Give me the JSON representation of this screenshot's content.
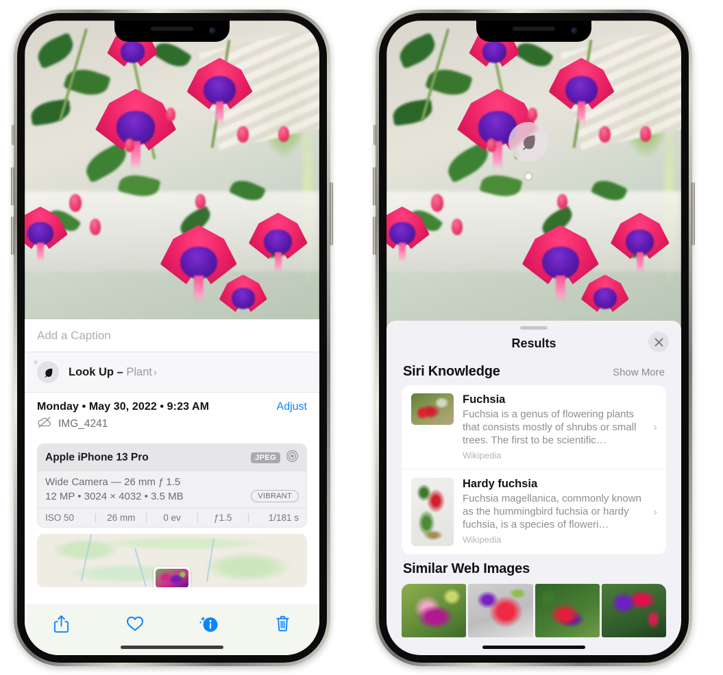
{
  "left_phone": {
    "photo": {
      "alt": "fuchsia-flowers-photo"
    },
    "caption": {
      "placeholder": "Add a Caption",
      "value": ""
    },
    "lookup": {
      "icon": "leaf-icon",
      "sparkle_icon": "sparkles-icon",
      "label": "Look Up – ",
      "subject": "Plant",
      "chevron": "›"
    },
    "meta": {
      "date": "Monday • May 30, 2022 • 9:23 AM",
      "adjust_label": "Adjust",
      "cloud_icon": "cloud-slash-icon",
      "filename": "IMG_4241"
    },
    "camera_card": {
      "device": "Apple iPhone 13 Pro",
      "format_badge": "JPEG",
      "lens_icon": "aperture-icon",
      "lens": "Wide Camera — 26 mm ƒ 1.5",
      "size_line": "12 MP • 3024 × 4032 • 3.5 MB",
      "vibrant_badge": "VIBRANT",
      "exif": [
        "ISO 50",
        "26 mm",
        "0 ev",
        "ƒ1.5",
        "1/181 s"
      ]
    },
    "map": {
      "name": "photo-location-map"
    },
    "toolbar": [
      {
        "name": "share-button",
        "icon": "share-icon"
      },
      {
        "name": "favorite-button",
        "icon": "heart-icon"
      },
      {
        "name": "info-button",
        "icon": "info-sparkle-icon"
      },
      {
        "name": "delete-button",
        "icon": "trash-icon"
      }
    ]
  },
  "right_phone": {
    "visual_lookup_badge": {
      "icon": "leaf-icon"
    },
    "sheet": {
      "title": "Results",
      "close_icon": "close-icon",
      "grabber": "drag-handle"
    },
    "siri_knowledge": {
      "title": "Siri Knowledge",
      "show_more": "Show More",
      "items": [
        {
          "title": "Fuchsia",
          "description": "Fuchsia is a genus of flowering plants that consists mostly of shrubs or small trees. The first to be scientific…",
          "source": "Wikipedia",
          "chevron": "›"
        },
        {
          "title": "Hardy fuchsia",
          "description": "Fuchsia magellanica, commonly known as the hummingbird fuchsia or hardy fuchsia, is a species of floweri…",
          "source": "Wikipedia",
          "chevron": "›"
        }
      ]
    },
    "similar_web_images": {
      "title": "Similar Web Images",
      "tiles": [
        "web-image-1",
        "web-image-2",
        "web-image-3",
        "web-image-4"
      ]
    }
  },
  "colors": {
    "accent_blue": "#0a84ff",
    "sheet_bg": "#f1f1f6",
    "card_bg": "#ffffff",
    "secondary_text": "#8e8e93"
  }
}
